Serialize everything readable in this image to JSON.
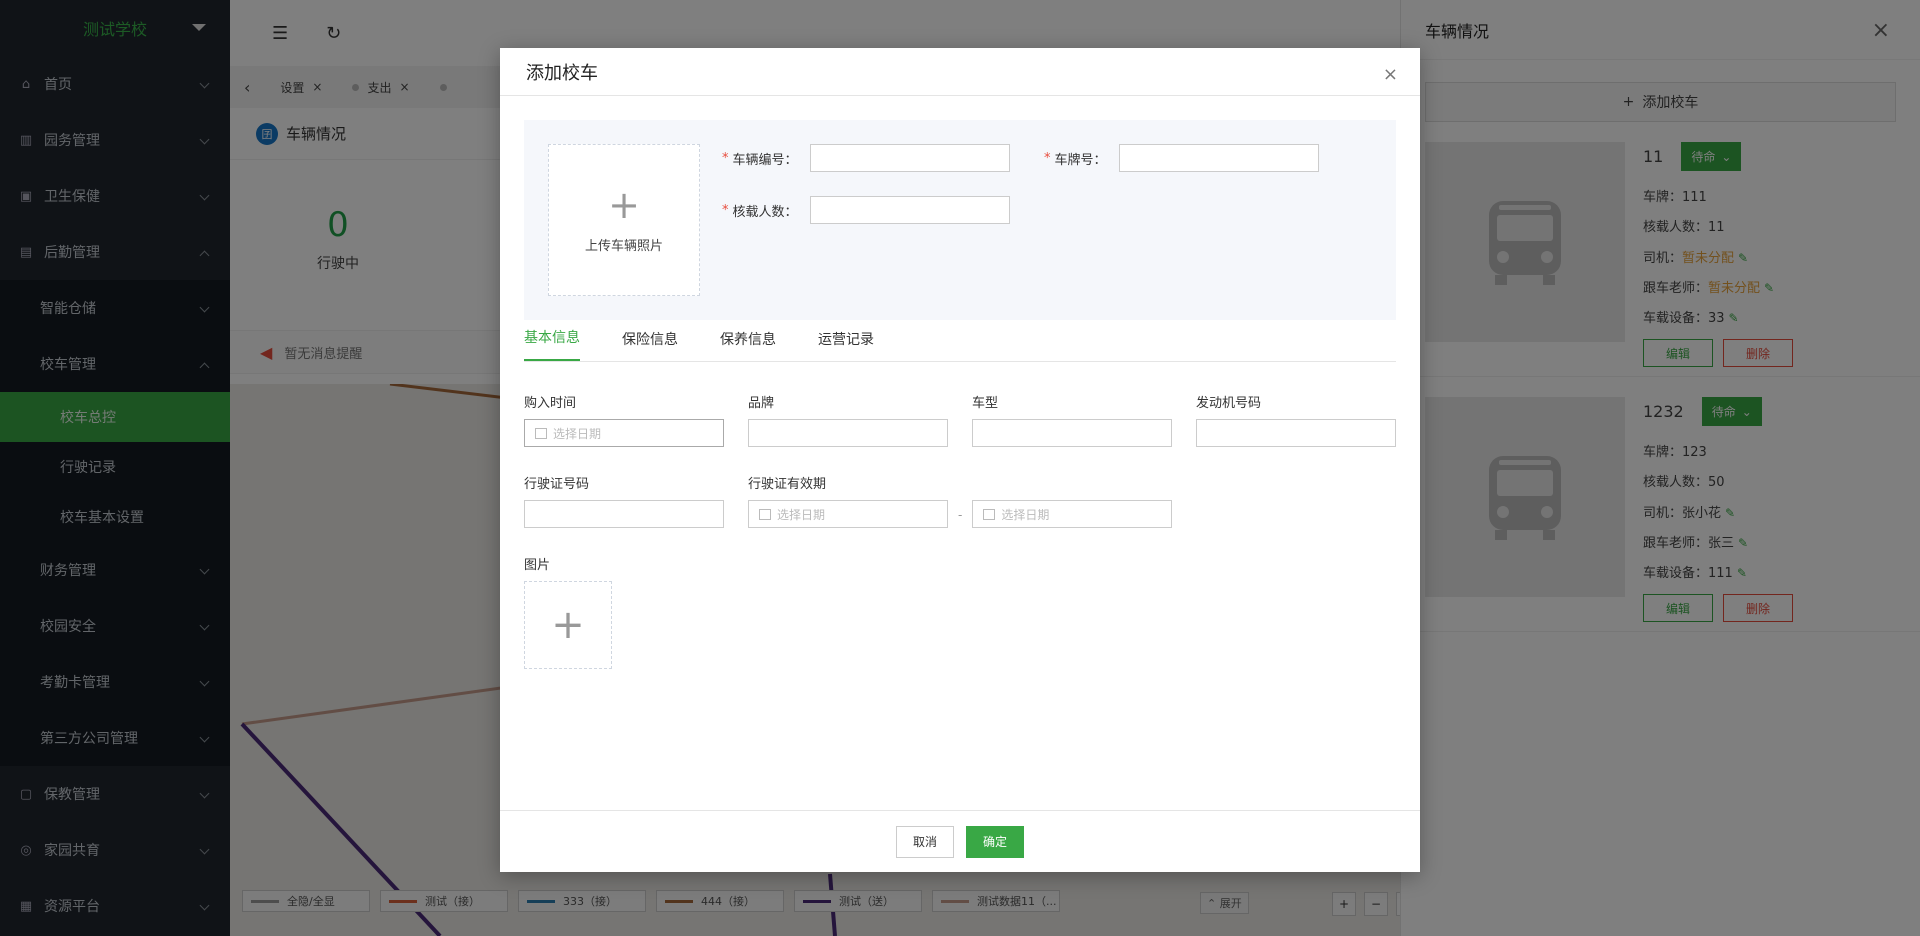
{
  "sidebar": {
    "school": "测试学校",
    "items": [
      {
        "label": "首页"
      },
      {
        "label": "园务管理"
      },
      {
        "label": "卫生保健"
      },
      {
        "label": "后勤管理"
      },
      {
        "label": "智能仓储"
      },
      {
        "label": "校车管理"
      },
      {
        "label": "校车总控"
      },
      {
        "label": "行驶记录"
      },
      {
        "label": "校车基本设置"
      },
      {
        "label": "财务管理"
      },
      {
        "label": "校园安全"
      },
      {
        "label": "考勤卡管理"
      },
      {
        "label": "第三方公司管理"
      },
      {
        "label": "保教管理"
      },
      {
        "label": "家园共育"
      },
      {
        "label": "资源平台"
      }
    ]
  },
  "tabs": [
    "设置",
    "支出"
  ],
  "panel": {
    "title": "车辆情况",
    "stat_value": "0",
    "stat_label": "行驶中",
    "notice": "暂无消息提醒",
    "expand": "展开"
  },
  "legend": [
    {
      "label": "全隐/全显",
      "color": "#9a9a9a"
    },
    {
      "label": "测试（接）",
      "color": "#d9603b"
    },
    {
      "label": "333（接）",
      "color": "#2d7fb0"
    },
    {
      "label": "444（接）",
      "color": "#a4683a"
    },
    {
      "label": "测试（送）",
      "color": "#4b2a78"
    },
    {
      "label": "测试数据11（...",
      "color": "#c49a8a"
    }
  ],
  "drawer": {
    "title": "车辆情况",
    "add_label": "添加校车",
    "cars": [
      {
        "no": "11",
        "status": "待命",
        "plate": "车牌：111",
        "seats": "核载人数：11",
        "driver_label": "司机：",
        "driver": "暂未分配",
        "teacher_label": "跟车老师：",
        "teacher": "暂未分配",
        "device": "车载设备：33",
        "edit": "编辑",
        "delete": "删除"
      },
      {
        "no": "1232",
        "status": "待命",
        "plate": "车牌：123",
        "seats": "核载人数：50",
        "driver_label": "司机：",
        "driver": "张小花",
        "teacher_label": "跟车老师：",
        "teacher": "张三",
        "device": "车载设备：111",
        "edit": "编辑",
        "delete": "删除"
      }
    ]
  },
  "modal": {
    "title": "添加校车",
    "upload_label": "上传车辆照片",
    "vehicle_no": "车辆编号：",
    "plate": "车牌号：",
    "seats": "核载人数：",
    "tabs": [
      "基本信息",
      "保险信息",
      "保养信息",
      "运营记录"
    ],
    "buy_time": "购入时间",
    "brand": "品牌",
    "model": "车型",
    "engine_no": "发动机号码",
    "license_no": "行驶证号码",
    "license_valid": "行驶证有效期",
    "date_placeholder": "选择日期",
    "range_sep": "-",
    "pictures": "图片",
    "cancel": "取消",
    "ok": "确定"
  }
}
